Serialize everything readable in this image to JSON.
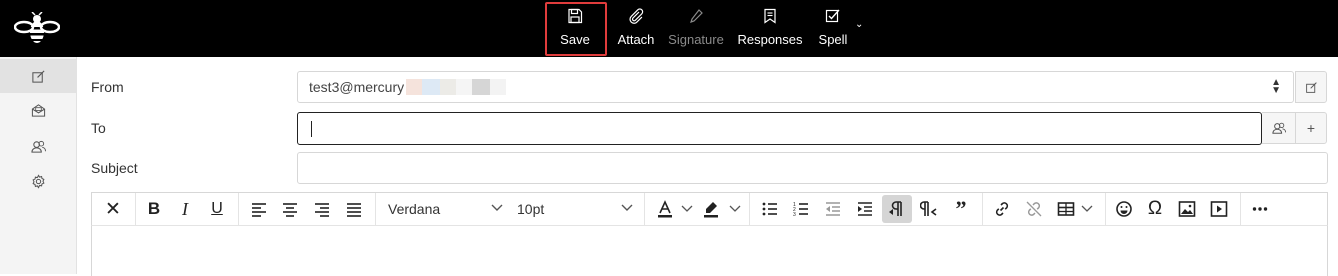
{
  "toolbar": {
    "save_label": "Save",
    "attach_label": "Attach",
    "signature_label": "Signature",
    "responses_label": "Responses",
    "spell_label": "Spell"
  },
  "sidebar": {
    "items": [
      {
        "name": "compose",
        "icon": "compose-icon",
        "active": true
      },
      {
        "name": "mail",
        "icon": "mail-icon",
        "active": false
      },
      {
        "name": "contacts",
        "icon": "contacts-icon",
        "active": false
      },
      {
        "name": "settings",
        "icon": "gear-icon",
        "active": false
      }
    ]
  },
  "form": {
    "from_label": "From",
    "from_value": "test3@mercury",
    "to_label": "To",
    "to_value": "",
    "subject_label": "Subject",
    "subject_value": "",
    "add_recipient": "+"
  },
  "editor": {
    "font_family": "Verdana",
    "font_size": "10pt"
  },
  "colors": {
    "topbar_bg": "#000000",
    "highlight": "#e03c3c",
    "sidebar_bg": "#f4f4f4"
  }
}
